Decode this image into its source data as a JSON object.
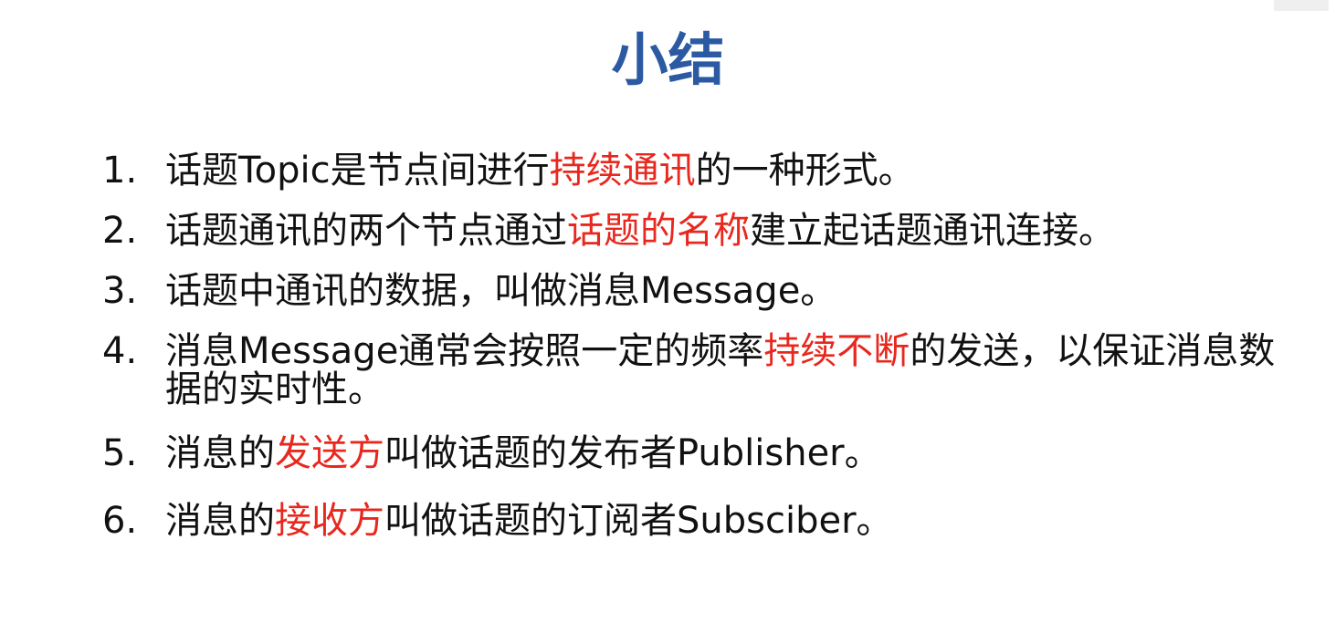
{
  "colors": {
    "title": "#2b5aa3",
    "highlight": "#e8281e",
    "text": "#111111"
  },
  "slide": {
    "title": "小结",
    "items": [
      {
        "number": "1.",
        "segments": [
          {
            "text": "话题Topic是节点间进行",
            "highlight": false
          },
          {
            "text": "持续通讯",
            "highlight": true
          },
          {
            "text": "的一种形式。",
            "highlight": false
          }
        ]
      },
      {
        "number": "2.",
        "segments": [
          {
            "text": "话题通讯的两个节点通过",
            "highlight": false
          },
          {
            "text": "话题的名称",
            "highlight": true
          },
          {
            "text": "建立起话题通讯连接。",
            "highlight": false
          }
        ]
      },
      {
        "number": "3.",
        "segments": [
          {
            "text": "话题中通讯的数据，叫做消息Message。",
            "highlight": false
          }
        ]
      },
      {
        "number": "4.",
        "segments": [
          {
            "text": "消息Message通常会按照一定的频率",
            "highlight": false
          },
          {
            "text": "持续不断",
            "highlight": true
          },
          {
            "text": "的发送，以保证消息数据的实时性。",
            "highlight": false
          }
        ]
      },
      {
        "number": "5.",
        "segments": [
          {
            "text": "消息的",
            "highlight": false
          },
          {
            "text": "发送方",
            "highlight": true
          },
          {
            "text": "叫做话题的发布者Publisher。",
            "highlight": false
          }
        ]
      },
      {
        "number": "6.",
        "segments": [
          {
            "text": "消息的",
            "highlight": false
          },
          {
            "text": "接收方",
            "highlight": true
          },
          {
            "text": "叫做话题的订阅者Subsciber。",
            "highlight": false
          }
        ]
      }
    ]
  }
}
